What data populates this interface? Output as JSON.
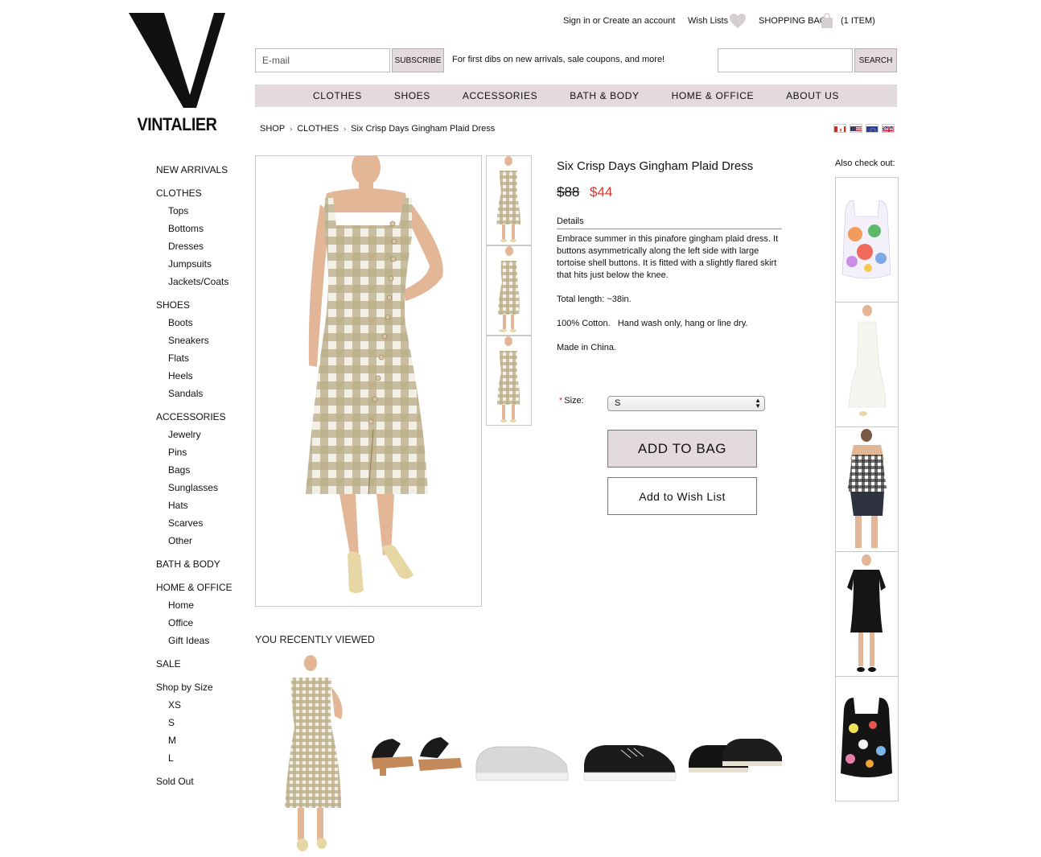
{
  "brand": {
    "name": "VINTALIER",
    "logo_icon": "vintalier-v-logo"
  },
  "account": {
    "signin_label": "Sign in or Create an account",
    "wishlists_label": "Wish Lists",
    "bag_label": "SHOPPING BAG",
    "bag_count": "(1 ITEM)"
  },
  "subscribe": {
    "email_placeholder": "E-mail",
    "button_label": "SUBSCRIBE",
    "promo_text": "For first dibs on new arrivals, sale coupons, and more!"
  },
  "search": {
    "value": "",
    "button_label": "SEARCH"
  },
  "nav": {
    "items": [
      {
        "label": "CLOTHES"
      },
      {
        "label": "SHOES"
      },
      {
        "label": "ACCESSORIES"
      },
      {
        "label": "BATH & BODY"
      },
      {
        "label": "HOME & OFFICE"
      },
      {
        "label": "ABOUT US"
      }
    ]
  },
  "breadcrumb": {
    "items": [
      "SHOP",
      "CLOTHES",
      "Six Crisp Days Gingham Plaid Dress"
    ],
    "separator": "›"
  },
  "currency_flags": [
    "canada-flag-icon",
    "usa-flag-icon",
    "eu-flag-icon",
    "uk-flag-icon"
  ],
  "sidebar": {
    "new_arrivals": "NEW ARRIVALS",
    "clothes": {
      "label": "CLOTHES",
      "items": [
        "Tops",
        "Bottoms",
        "Dresses",
        "Jumpsuits",
        "Jackets/Coats"
      ]
    },
    "shoes": {
      "label": "SHOES",
      "items": [
        "Boots",
        "Sneakers",
        "Flats",
        "Heels",
        "Sandals"
      ]
    },
    "accessories": {
      "label": "ACCESSORIES",
      "items": [
        "Jewelry",
        "Pins",
        "Bags",
        "Sunglasses",
        "Hats",
        "Scarves",
        "Other"
      ]
    },
    "bath_body": "BATH & BODY",
    "home_office": {
      "label": "HOME & OFFICE",
      "items": [
        "Home",
        "Office",
        "Gift Ideas"
      ]
    },
    "sale": "SALE",
    "shop_by_size": {
      "label": "Shop by Size",
      "items": [
        "XS",
        "S",
        "M",
        "L"
      ]
    },
    "sold_out": "Sold Out"
  },
  "product": {
    "title": "Six Crisp Days Gingham Plaid Dress",
    "price_original": "$88",
    "price_sale": "$44",
    "details_label": "Details",
    "description": [
      "Embrace summer in this pinafore gingham plaid dress. It buttons asymmetrically along the left side with large tortoise shell buttons. It is fitted with a slightly flared skirt that hits just below the knee.",
      "Total length: ~38in.",
      "100% Cotton.   Hand wash only, hang or line dry.",
      "Made in China."
    ],
    "size_label": "Size:",
    "size_required_mark": "*",
    "size_selected": "S",
    "add_to_bag_label": "ADD TO BAG",
    "add_to_wishlist_label": "Add to Wish List"
  },
  "also_check_out": {
    "title": "Also check out:"
  },
  "recently_viewed": {
    "title": "YOU RECENTLY VIEWED"
  },
  "colors": {
    "accent_grey": "#e2dadb",
    "sale_red": "#e0342c",
    "gingham": "#a99a6f"
  }
}
